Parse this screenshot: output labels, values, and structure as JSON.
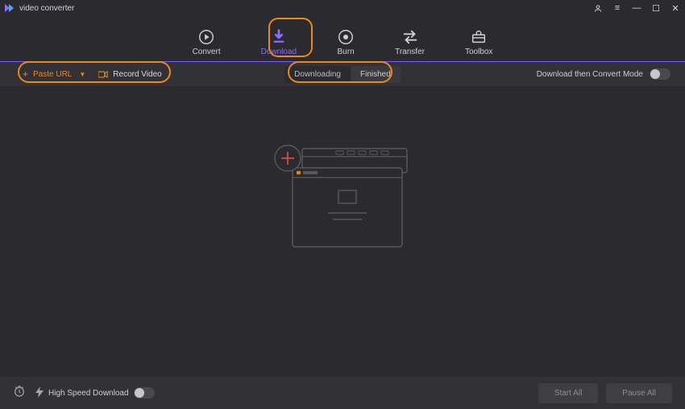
{
  "app": {
    "title": "video converter"
  },
  "window_controls": {
    "user": "user",
    "menu": "≡",
    "min": "—",
    "max": "☐",
    "close": "✕"
  },
  "tabs": {
    "convert": {
      "label": "Convert"
    },
    "download": {
      "label": "Download",
      "active": true
    },
    "burn": {
      "label": "Burn"
    },
    "transfer": {
      "label": "Transfer"
    },
    "toolbox": {
      "label": "Toolbox"
    }
  },
  "toolbar": {
    "paste_url_label": "Paste URL",
    "record_video_label": "Record Video",
    "segments": {
      "downloading": "Downloading",
      "finished": "Finished",
      "active": "downloading"
    },
    "convert_mode_label": "Download then Convert Mode"
  },
  "footer": {
    "high_speed_label": "High Speed Download",
    "start_all": "Start All",
    "pause_all": "Pause All"
  },
  "colors": {
    "accent": "#8c6bff",
    "highlight": "#e88a1f",
    "bg": "#2b2a2e"
  }
}
